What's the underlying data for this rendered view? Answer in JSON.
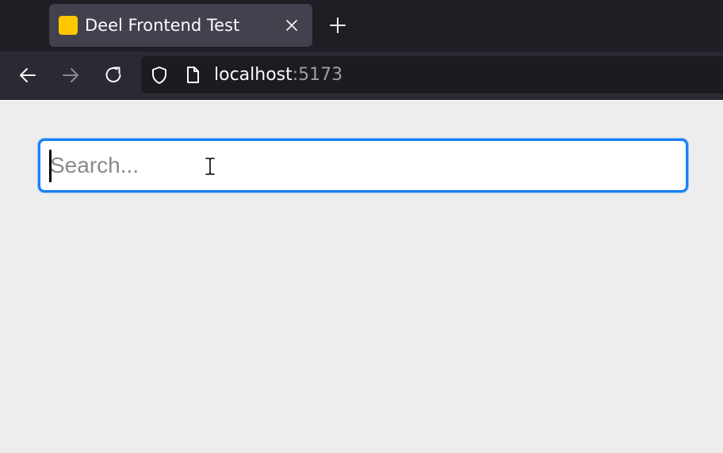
{
  "browser": {
    "tab": {
      "title": "Deel Frontend Test",
      "favicon_color": "#ffc700",
      "close_icon": "close-icon"
    },
    "new_tab_icon": "plus-icon",
    "nav": {
      "back_icon": "arrow-left-icon",
      "forward_icon": "arrow-right-icon",
      "forward_enabled": false,
      "reload_icon": "reload-icon"
    },
    "url": {
      "host": "localhost",
      "port": ":5173",
      "security_icon": "shield-icon",
      "page_icon": "page-icon"
    }
  },
  "page": {
    "search": {
      "placeholder": "Search...",
      "value": "",
      "focused": true,
      "focus_color": "#1a7ff2"
    }
  }
}
